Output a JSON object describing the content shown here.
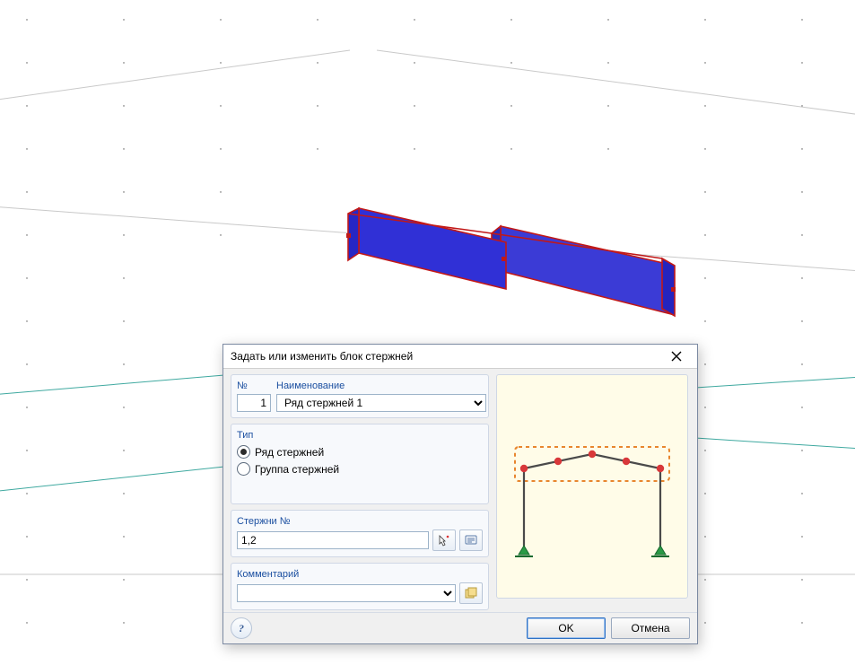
{
  "dialog": {
    "title": "Задать или изменить блок стержней",
    "labels": {
      "number": "№",
      "name": "Наименование",
      "type": "Тип",
      "members": "Стержни №",
      "comment": "Комментарий"
    },
    "fields": {
      "number": "1",
      "name_selected": "Ряд стержней 1",
      "members": "1,2",
      "comment_selected": ""
    },
    "type_options": {
      "row": "Ряд стержней",
      "group": "Группа стержней"
    },
    "type_selected": "row",
    "buttons": {
      "ok": "OK",
      "cancel": "Отмена"
    }
  }
}
